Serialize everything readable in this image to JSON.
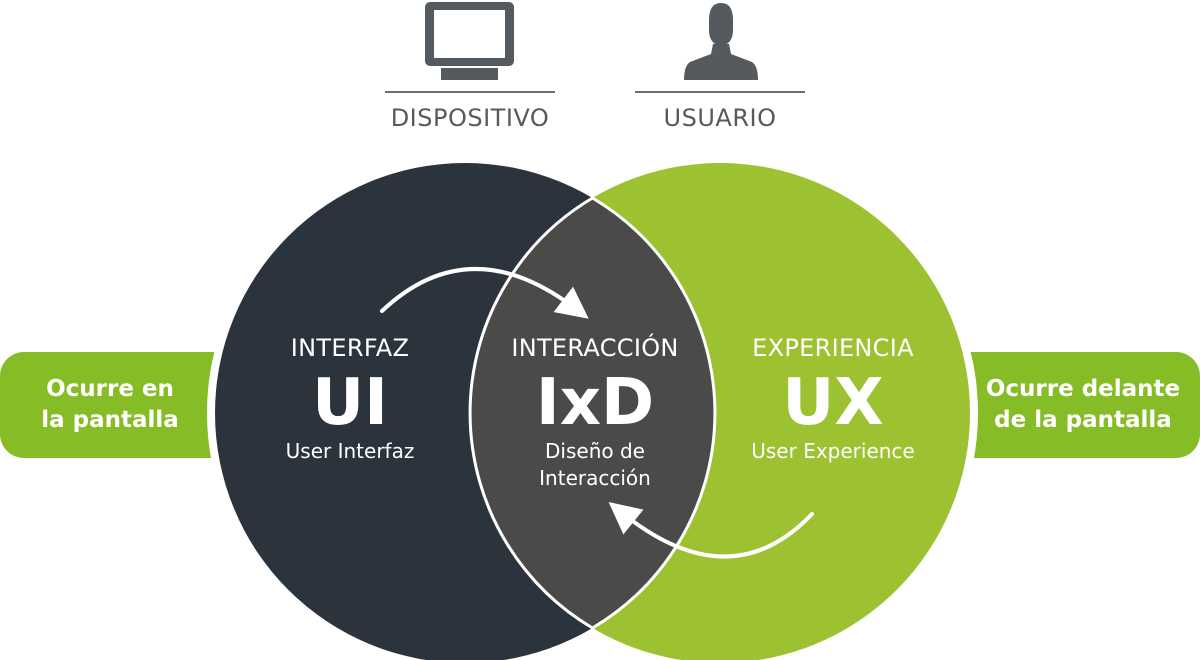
{
  "top": {
    "device_label": "DISPOSITIVO",
    "user_label": "USUARIO"
  },
  "left_tab": {
    "line1": "Ocurre en",
    "line2": "la pantalla"
  },
  "right_tab": {
    "line1": "Ocurre delante",
    "line2": "de la pantalla"
  },
  "ui": {
    "heading": "INTERFAZ",
    "acronym": "UI",
    "subtitle": "User Interfaz"
  },
  "ixd": {
    "heading": "INTERACCIÓN",
    "acronym": "IxD",
    "subtitle_line1": "Diseño de",
    "subtitle_line2": "Interacción"
  },
  "ux": {
    "heading": "EXPERIENCIA",
    "acronym": "UX",
    "subtitle": "User Experience"
  },
  "colors": {
    "dark_circle": "#2b343d",
    "green_circle": "#9cc232",
    "overlap": "#4a4a49",
    "green_tab": "#86bc25",
    "icon_gray": "#555a5e",
    "line_gray": "#6b6e71",
    "white": "#ffffff"
  },
  "icons": {
    "device": "monitor-icon",
    "user": "person-icon"
  }
}
